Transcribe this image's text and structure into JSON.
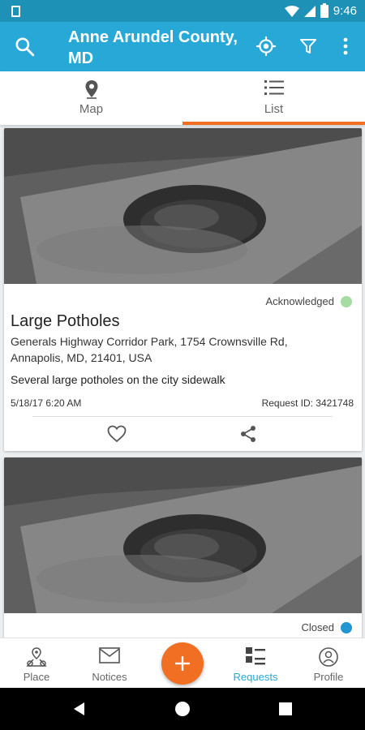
{
  "status_bar": {
    "time": "9:46"
  },
  "app_bar": {
    "title": "Anne Arundel County, MD",
    "icons": [
      "search-icon",
      "my-location-icon",
      "filter-icon",
      "more-vert-icon"
    ]
  },
  "tabs": [
    {
      "label": "Map",
      "icon": "map-pin-icon",
      "selected": false
    },
    {
      "label": "List",
      "icon": "list-icon",
      "selected": true
    }
  ],
  "colors": {
    "primary": "#27a8d6",
    "status_bar": "#1d92b6",
    "accent": "#f06f22",
    "acknowledged": "#a4dca2",
    "closed": "#2196d3"
  },
  "cards": [
    {
      "status": "Acknowledged",
      "status_color": "#a4dca2",
      "title": "Large Potholes",
      "address": "Generals Highway Corridor Park, 1754 Crownsville Rd, Annapolis, MD, 21401, USA",
      "description": "Several large potholes on the city sidewalk",
      "date": "5/18/17 6:20 AM",
      "request_id": "Request ID: 3421748"
    },
    {
      "status": "Closed",
      "status_color": "#2196d3"
    }
  ],
  "bottom_nav": {
    "items": [
      {
        "label": "Place",
        "icon": "place-icon",
        "active": false
      },
      {
        "label": "Notices",
        "icon": "mail-icon",
        "active": false
      },
      {
        "label": "Requests",
        "icon": "requests-icon",
        "active": true
      },
      {
        "label": "Profile",
        "icon": "profile-icon",
        "active": false
      }
    ],
    "fab_icon": "plus-icon"
  },
  "system_nav": [
    "back-icon",
    "home-icon",
    "recents-icon"
  ]
}
